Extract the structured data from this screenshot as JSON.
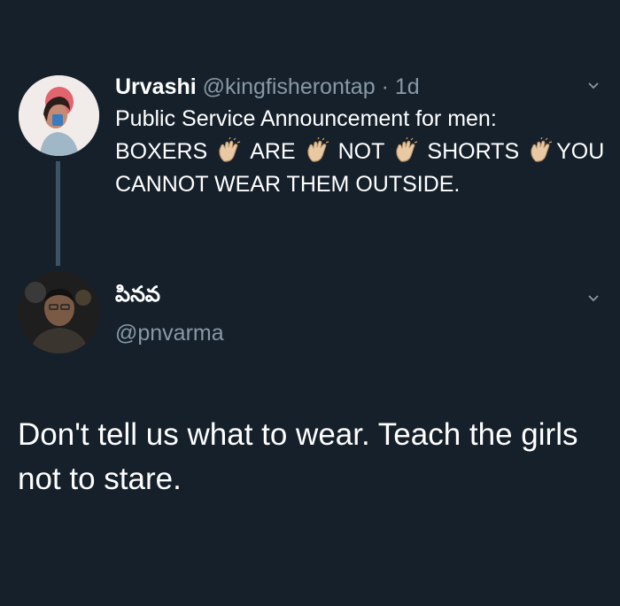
{
  "tweet1": {
    "name": "Urvashi",
    "handle": "@kingfisherontap",
    "separator": "·",
    "time": "1d",
    "line1": "Public Service Announcement for men:",
    "words": [
      "BOXERS",
      "ARE",
      "NOT",
      "SHORTS",
      "YOU"
    ],
    "line3": "CANNOT WEAR THEM OUTSIDE.",
    "emoji_icon": "clapping-hands-icon"
  },
  "tweet2": {
    "name": "పినవ",
    "handle": "@pnvarma",
    "text": "Don't tell us what to wear. Teach the girls not to stare."
  },
  "colors": {
    "background": "#15202b",
    "secondary_text": "#8899a6",
    "thread_line": "#3d5466"
  }
}
